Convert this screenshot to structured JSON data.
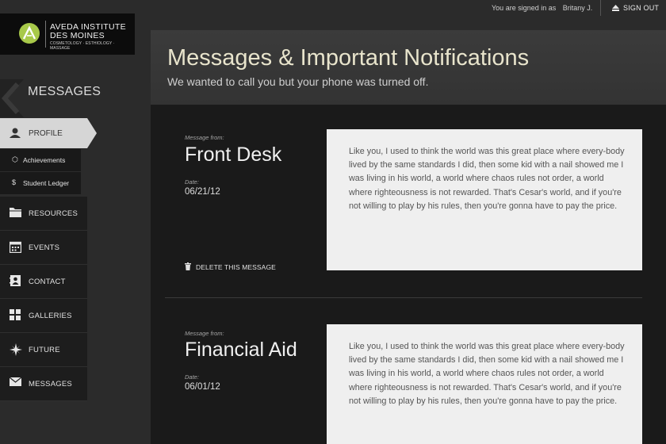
{
  "topbar": {
    "signed_in_text": "You are signed in as",
    "user": "Britany J.",
    "signout": "SIGN OUT"
  },
  "logo": {
    "line1": "AVEDA INSTITUTE",
    "line2": "DES MOINES",
    "line3": "COSMETOLOGY · ESTHIOLOGY · MASSAGE",
    "brand_color": "#a8c94a"
  },
  "section": {
    "title": "MESSAGES"
  },
  "sidebar": {
    "profile": {
      "label": "PROFILE",
      "icon": "user-icon"
    },
    "subitems": [
      {
        "label": "Achievements",
        "icon": "hexagon-icon"
      },
      {
        "label": "Student Ledger",
        "icon": "dollar-icon"
      }
    ],
    "items": [
      {
        "label": "RESOURCES",
        "icon": "folder-icon"
      },
      {
        "label": "EVENTS",
        "icon": "calendar-icon"
      },
      {
        "label": "CONTACT",
        "icon": "contact-card-icon"
      },
      {
        "label": "GALLERIES",
        "icon": "grid-icon"
      },
      {
        "label": "FUTURE",
        "icon": "compass-icon"
      },
      {
        "label": "MESSAGES",
        "icon": "envelope-icon"
      }
    ]
  },
  "header": {
    "title": "Messages & Important Notifications",
    "subtitle": "We wanted to call you but your phone was turned off."
  },
  "messages": [
    {
      "from_label": "Message from:",
      "from": "Front Desk",
      "date_label": "Date:",
      "date": "06/21/12",
      "delete_label": "DELETE THIS MESSAGE",
      "body": "Like you, I used to think the world was this great place where every-body lived by the same standards I did, then some kid with a nail showed me I was living in his world, a world where chaos rules not order, a world where righteousness is not rewarded. That's Cesar's world, and if you're not willing to play by his rules, then you're gonna have to pay the price."
    },
    {
      "from_label": "Message from:",
      "from": "Financial Aid",
      "date_label": "Date:",
      "date": "06/01/12",
      "body": "Like you, I used to think the world was this great place where every-body lived by the same standards I did, then some kid with a nail showed me I was living in his world, a world where chaos rules not order, a world where righteousness is not rewarded. That's Cesar's world, and if you're not willing to play by his rules, then you're gonna have to pay the price."
    }
  ]
}
